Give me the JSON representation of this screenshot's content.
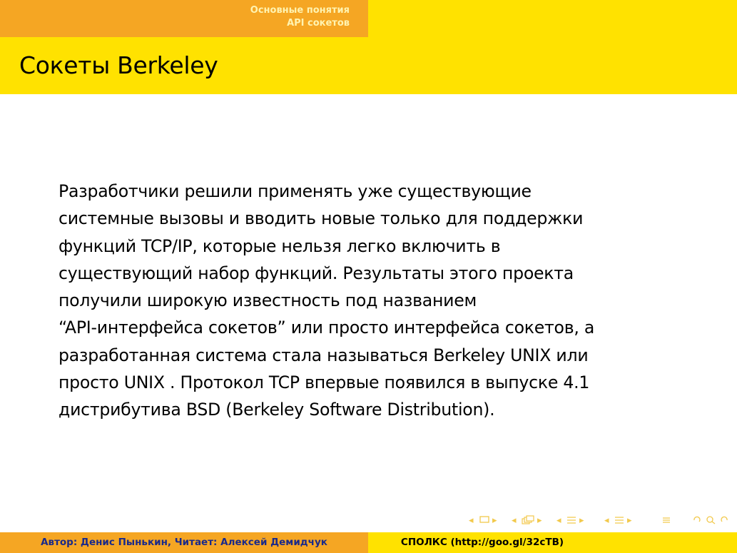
{
  "header": {
    "section": "Основные понятия",
    "subsection": "API сокетов"
  },
  "frame": {
    "title": "Сокеты Berkeley",
    "body_lines": [
      "Разработчики решили применять уже существующие",
      "системные вызовы и вводить новые только для поддержки",
      "функций TCP/IP, которые нельзя легко включить в",
      "существующий набор функций. Результаты этого проекта",
      "получили широкую известность под названием",
      "“API-интерфейса сокетов” или просто интерфейса сокетов, а",
      "разработанная система стала называться Berkeley UNIX или",
      "просто UNIX . Протокол TCP впервые появился в выпуске 4.1",
      "дистрибутива BSD (Berkeley Software Distribution)."
    ]
  },
  "navigation": {
    "icons": [
      "nav-prev-arrow-icon",
      "frame-icon",
      "nav-next-arrow-icon",
      "nav-prev-arrow-icon",
      "slide-stack-icon",
      "nav-next-arrow-icon",
      "nav-prev-arrow-icon",
      "subsection-icon",
      "nav-next-arrow-icon",
      "nav-prev-arrow-icon",
      "section-icon",
      "nav-next-arrow-icon",
      "align-icon",
      "search-back-forward-icon"
    ]
  },
  "footer": {
    "author": "Автор: Денис Пынькин, Читает: Алексей Демидчук",
    "title": "СПОЛКС (http://goo.gl/32cTB)"
  },
  "colors": {
    "accent_yellow": "#ffe200",
    "accent_orange": "#f5a623",
    "footer_author_text": "#1a2a8a"
  }
}
